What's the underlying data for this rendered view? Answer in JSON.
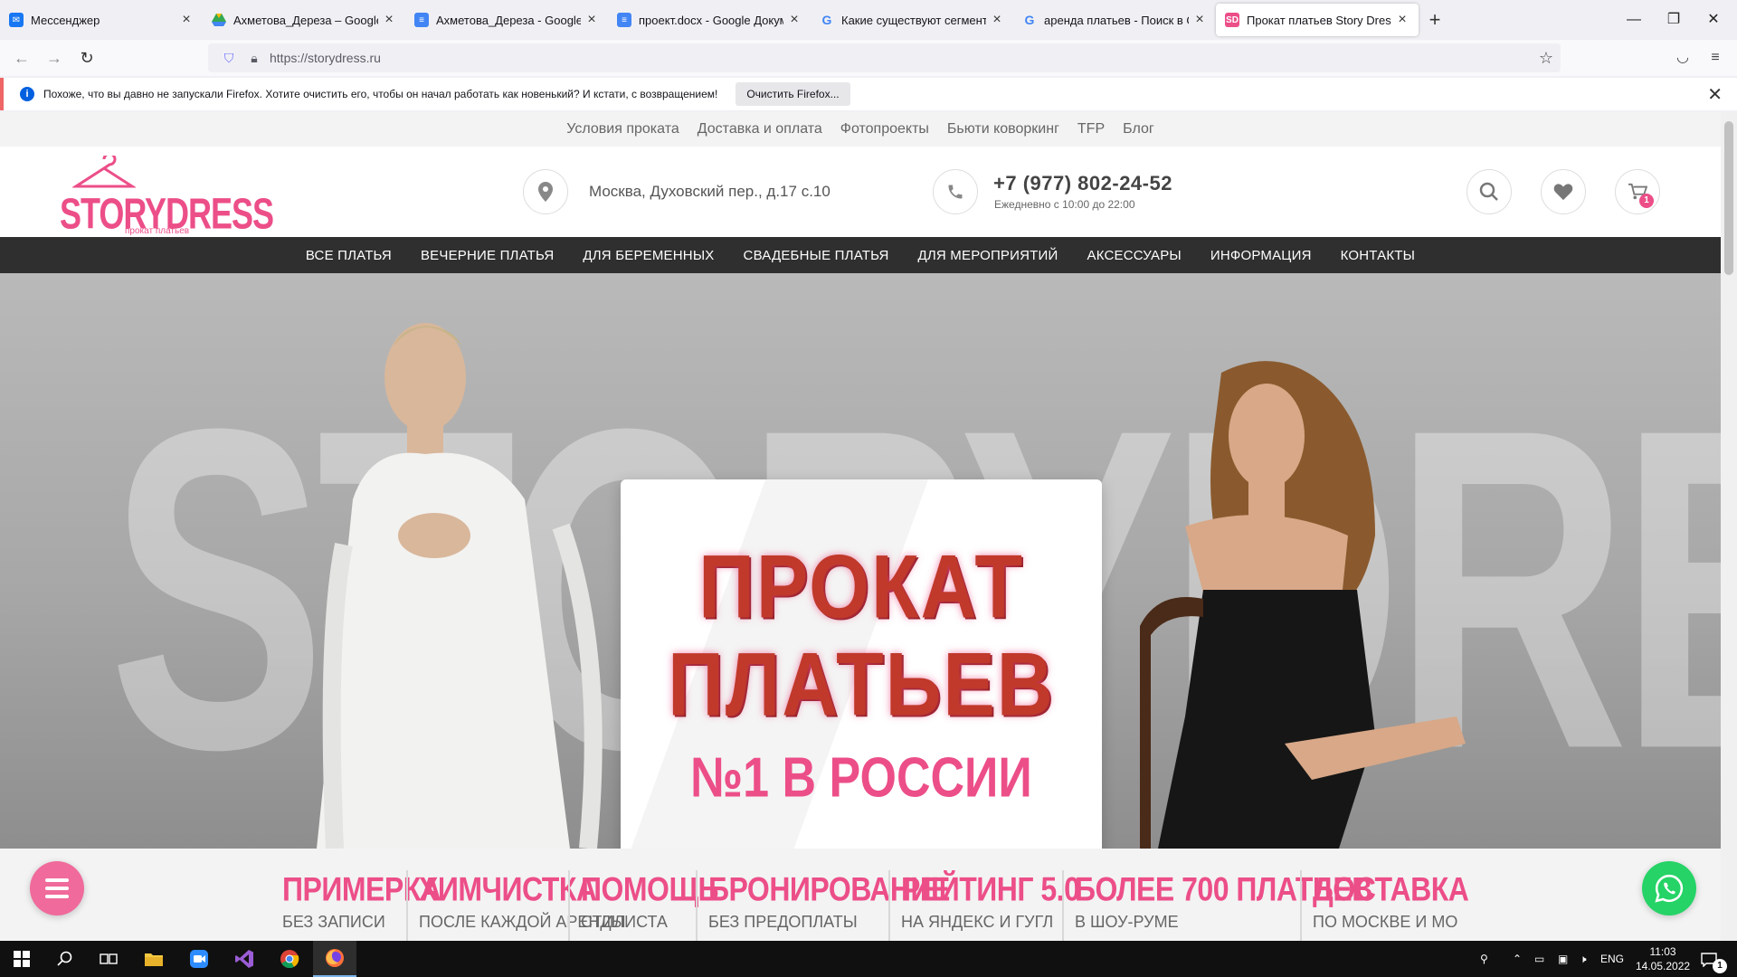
{
  "browser": {
    "tabs": [
      {
        "title": "Мессенджер",
        "icon": "messenger-icon",
        "color": "#1877f2"
      },
      {
        "title": "Ахметова_Дереза – Google Ди",
        "icon": "google-drive-icon",
        "color": "#34a853"
      },
      {
        "title": "Ахметова_Дереза - Google До",
        "icon": "google-docs-icon",
        "color": "#4285f4"
      },
      {
        "title": "проект.docx - Google Докумен",
        "icon": "google-docs-icon",
        "color": "#4285f4"
      },
      {
        "title": "Какие существуют сегменты р",
        "icon": "google-icon",
        "color": "#ea4335"
      },
      {
        "title": "аренда платьев - Поиск в Goo",
        "icon": "google-icon",
        "color": "#ea4335"
      },
      {
        "title": "Прокат платьев Story Dress",
        "icon": "storydress-favicon",
        "color": "#ec4e88",
        "active": true
      }
    ],
    "new_tab": "+",
    "url": "https://storydress.ru",
    "notification": {
      "text": "Похоже, что вы давно не запускали Firefox. Хотите очистить его, чтобы он начал работать как новенький? И кстати, с возвращением!",
      "button": "Очистить Firefox..."
    }
  },
  "site": {
    "top_links": [
      "Условия проката",
      "Доставка и оплата",
      "Фотопроекты",
      "Бьюти коворкинг",
      "TFP",
      "Блог"
    ],
    "logo": {
      "word": "STORYDRESS",
      "sub": "прокат платьев"
    },
    "address": "Москва, Духовский пер., д.17 с.10",
    "phone": "+7 (977) 802-24-52",
    "hours": "Ежедневно с 10:00 до 22:00",
    "cart_count": "1",
    "menu": [
      "ВСЕ ПЛАТЬЯ",
      "ВЕЧЕРНИЕ ПЛАТЬЯ",
      "ДЛЯ БЕРЕМЕННЫХ",
      "СВАДЕБНЫЕ ПЛАТЬЯ",
      "ДЛЯ МЕРОПРИЯТИЙ",
      "АКСЕССУАРЫ",
      "ИНФОРМАЦИЯ",
      "КОНТАКТЫ"
    ],
    "hero": {
      "background_word": "STORYDRESS",
      "line1": "ПРОКАТ",
      "line2": "ПЛАТЬЕВ",
      "line3": "№1 В РОССИИ"
    },
    "features": [
      {
        "title": "ПРИМЕРКА",
        "sub": "БЕЗ ЗАПИСИ"
      },
      {
        "title": "ХИМЧИСТКА",
        "sub": "ПОСЛЕ КАЖДОЙ АРЕНДЫ"
      },
      {
        "title": "ПОМОЩЬ",
        "sub": "СТИЛИСТА"
      },
      {
        "title": "БРОНИРОВАНИЕ",
        "sub": "БЕЗ ПРЕДОПЛАТЫ"
      },
      {
        "title": "РЕЙТИНГ 5.0",
        "sub": "НА ЯНДЕКС И ГУГЛ"
      },
      {
        "title": "БОЛЕЕ 700 ПЛАТЬЕВ",
        "sub": "В ШОУ-РУМЕ"
      },
      {
        "title": "ДОСТАВКА",
        "sub": "ПО МОСКВЕ И МО"
      }
    ],
    "colors": {
      "brand_pink": "#ec4e88",
      "menu_bg": "#2f2f2f",
      "whatsapp": "#25d366"
    }
  },
  "taskbar": {
    "language": "ENG",
    "time": "11:03",
    "date": "14.05.2022",
    "notifications": "1"
  }
}
